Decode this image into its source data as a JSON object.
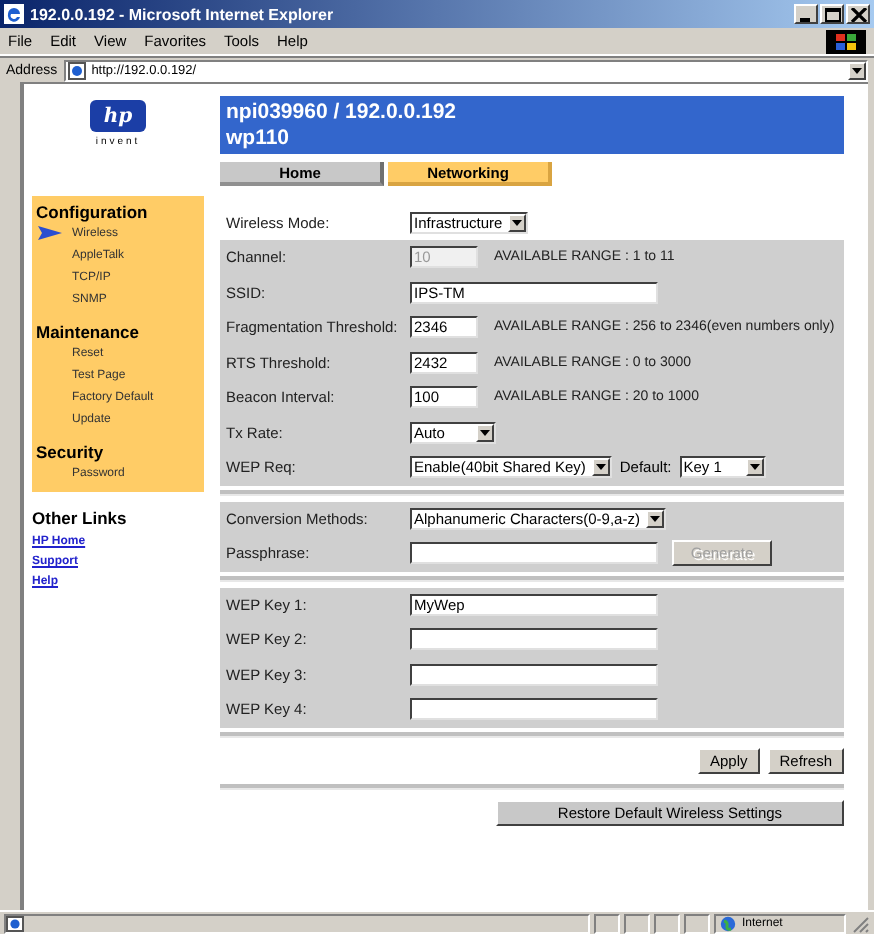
{
  "window": {
    "title": "192.0.0.192 - Microsoft Internet Explorer"
  },
  "menu": [
    "File",
    "Edit",
    "View",
    "Favorites",
    "Tools",
    "Help"
  ],
  "address_bar": {
    "label": "Address",
    "value": "http://192.0.0.192/"
  },
  "logo": {
    "mark": "hp",
    "tagline": "invent"
  },
  "header": {
    "lines": [
      "npi039960 / 192.0.0.192",
      "wp110"
    ]
  },
  "tabs": [
    {
      "label": "Home",
      "selected": false
    },
    {
      "label": "Networking",
      "selected": true
    }
  ],
  "sidebar": {
    "sections": [
      {
        "title": "Configuration",
        "items": [
          {
            "label": "Wireless",
            "selected": true
          },
          {
            "label": "AppleTalk",
            "selected": false
          },
          {
            "label": "TCP/IP",
            "selected": false
          },
          {
            "label": "SNMP",
            "selected": false
          }
        ]
      },
      {
        "title": "Maintenance",
        "items": [
          {
            "label": "Reset",
            "selected": false
          },
          {
            "label": "Test Page",
            "selected": false
          },
          {
            "label": "Factory Default",
            "selected": false
          },
          {
            "label": "Update",
            "selected": false
          }
        ]
      },
      {
        "title": "Security",
        "items": [
          {
            "label": "Password",
            "selected": false
          }
        ]
      }
    ]
  },
  "other_links": {
    "title": "Other Links",
    "links": [
      "HP Home",
      "Support",
      "Help"
    ]
  },
  "wireless_mode": {
    "label": "Wireless Mode:",
    "value": "Infrastructure"
  },
  "groups": [
    [
      {
        "kind": "number",
        "label": "Channel:",
        "value": "10",
        "disabled": true,
        "hint": "AVAILABLE RANGE : 1 to 11"
      },
      {
        "kind": "text",
        "label": "SSID:",
        "value": "IPS-TM",
        "disabled": false
      },
      {
        "kind": "number",
        "label": "Fragmentation Threshold:",
        "value": "2346",
        "disabled": false,
        "hint": "AVAILABLE RANGE : 256 to 2346(even numbers only)"
      },
      {
        "kind": "number",
        "label": "RTS Threshold:",
        "value": "2432",
        "disabled": false,
        "hint": "AVAILABLE RANGE : 0 to 3000"
      },
      {
        "kind": "number",
        "label": "Beacon Interval:",
        "value": "100",
        "disabled": false,
        "hint": "AVAILABLE RANGE : 20 to 1000"
      },
      {
        "kind": "select",
        "label": "Tx Rate:",
        "value": "Auto",
        "disabled": false
      },
      {
        "kind": "select",
        "label": "WEP Req:",
        "value": "Enable(40bit Shared Key)",
        "disabled": false,
        "extra": {
          "label": "Default:",
          "value": "Key 1"
        }
      }
    ],
    [
      {
        "kind": "select",
        "label": "Conversion Methods:",
        "value": "Alphanumeric Characters(0-9,a-z)",
        "disabled": false
      },
      {
        "kind": "text",
        "label": "Passphrase:",
        "disabled": false,
        "button": {
          "label": "Generate",
          "disabled": true
        }
      }
    ],
    [
      {
        "kind": "text",
        "label": "WEP Key 1:",
        "value": "MyWep",
        "disabled": false
      },
      {
        "kind": "text",
        "label": "WEP Key 2:",
        "disabled": false
      },
      {
        "kind": "text",
        "label": "WEP Key 3:",
        "disabled": false
      },
      {
        "kind": "text",
        "label": "WEP Key 4:",
        "disabled": false
      }
    ]
  ],
  "actions": [
    "Apply",
    "Refresh"
  ],
  "restore_button": "Restore Default Wireless Settings",
  "status_bar": {
    "zone": "Internet"
  }
}
